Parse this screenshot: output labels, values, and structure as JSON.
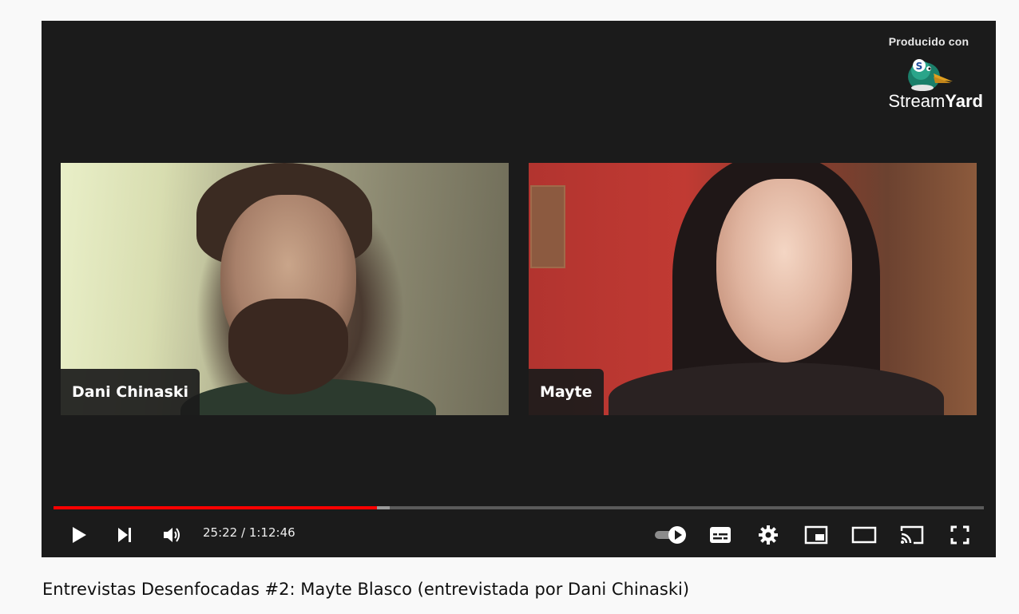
{
  "branding": {
    "caption": "Producido con",
    "name_regular": "Stream",
    "name_bold": "Yard"
  },
  "participants": [
    {
      "name": "Dani Chinaski"
    },
    {
      "name": "Mayte"
    }
  ],
  "playback": {
    "current_time": "25:22",
    "separator": " / ",
    "duration": "1:12:46",
    "played_fraction": 0.348,
    "buffered_fraction": 0.361
  },
  "controls": {
    "icons": [
      "play-icon",
      "next-icon",
      "volume-icon",
      "autoplay-toggle-icon",
      "subtitles-icon",
      "settings-icon",
      "miniplayer-icon",
      "theater-mode-icon",
      "cast-icon",
      "fullscreen-icon"
    ]
  },
  "colors": {
    "progress_played": "#ff0000",
    "player_background": "#1b1b1b",
    "page_background": "#f9f9f9"
  },
  "video": {
    "title": "Entrevistas Desenfocadas #2: Mayte Blasco (entrevistada por Dani Chinaski)"
  }
}
